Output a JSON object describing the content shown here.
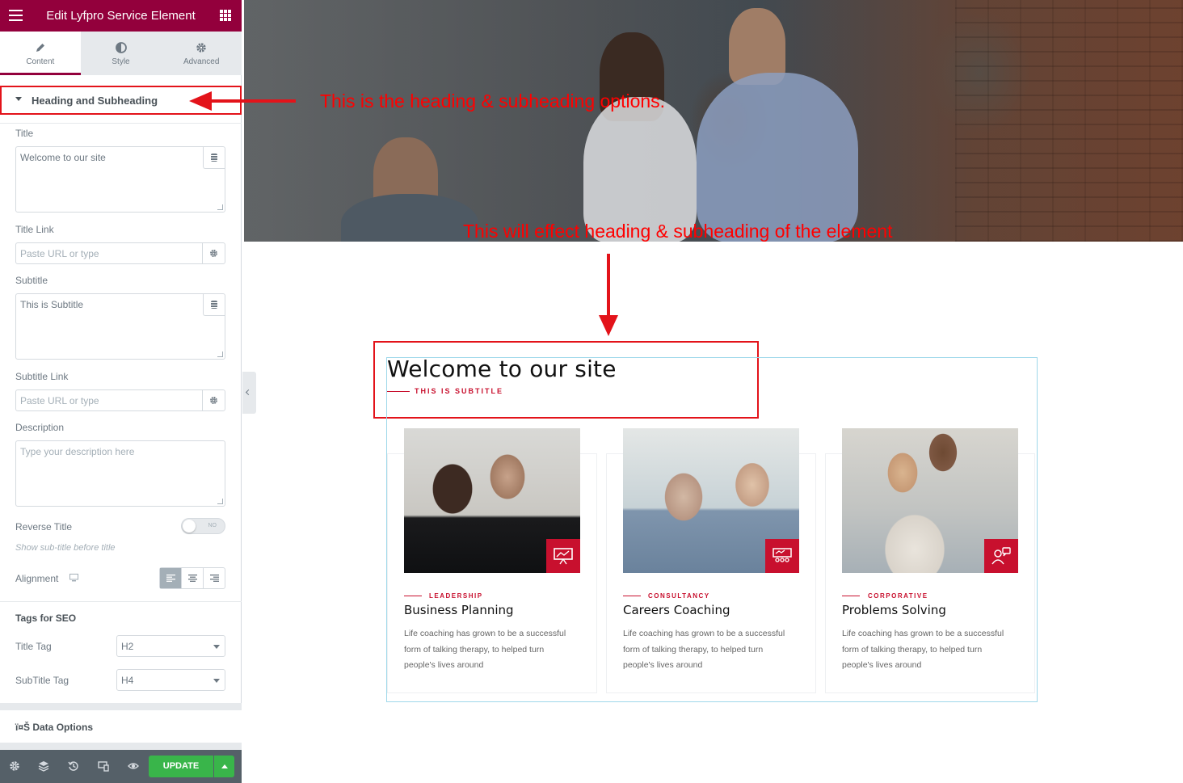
{
  "panel": {
    "header_title": "Edit Lyfpro Service Element",
    "tabs": [
      {
        "label": "Content",
        "icon": "pencil-icon"
      },
      {
        "label": "Style",
        "icon": "half-circle-icon"
      },
      {
        "label": "Advanced",
        "icon": "gear-icon"
      }
    ],
    "section_title": "Heading and Subheading",
    "title_label": "Title",
    "title_value": "Welcome to our site",
    "title_link_label": "Title Link",
    "url_placeholder": "Paste URL or type",
    "subtitle_label": "Subtitle",
    "subtitle_value": "This is Subtitle",
    "subtitle_link_label": "Subtitle Link",
    "description_label": "Description",
    "description_placeholder": "Type your description here",
    "reverse_title_label": "Reverse Title",
    "reverse_toggle_text": "NO",
    "reverse_hint": "Show sub-title before title",
    "alignment_label": "Alignment",
    "seo_heading": "Tags for SEO",
    "title_tag_label": "Title Tag",
    "title_tag_value": "H2",
    "subtitle_tag_label": "SubTitle Tag",
    "subtitle_tag_value": "H4",
    "data_options_label": "ï¤Š Data Options",
    "update_label": "UPDATE"
  },
  "annotations": {
    "top": "This is the heading & subheading options.",
    "middle": "This will effect heading & subheading of the element"
  },
  "preview": {
    "title": "Welcome to our site",
    "subtitle": "THIS IS SUBTITLE",
    "cards": [
      {
        "category": "LEADERSHIP",
        "title": "Business Planning",
        "desc": "Life coaching has grown to be a successful form of talking therapy, to helped turn people's lives around"
      },
      {
        "category": "CONSULTANCY",
        "title": "Careers Coaching",
        "desc": "Life coaching has grown to be a successful form of talking therapy, to helped turn people's lives around"
      },
      {
        "category": "CORPORATIVE",
        "title": "Problems Solving",
        "desc": "Life coaching has grown to be a successful form of talking therapy, to helped turn people's lives around"
      }
    ]
  },
  "colors": {
    "brand": "#93003c",
    "accent": "#c8102e",
    "update": "#39b54a",
    "annotation": "#ff0000"
  }
}
